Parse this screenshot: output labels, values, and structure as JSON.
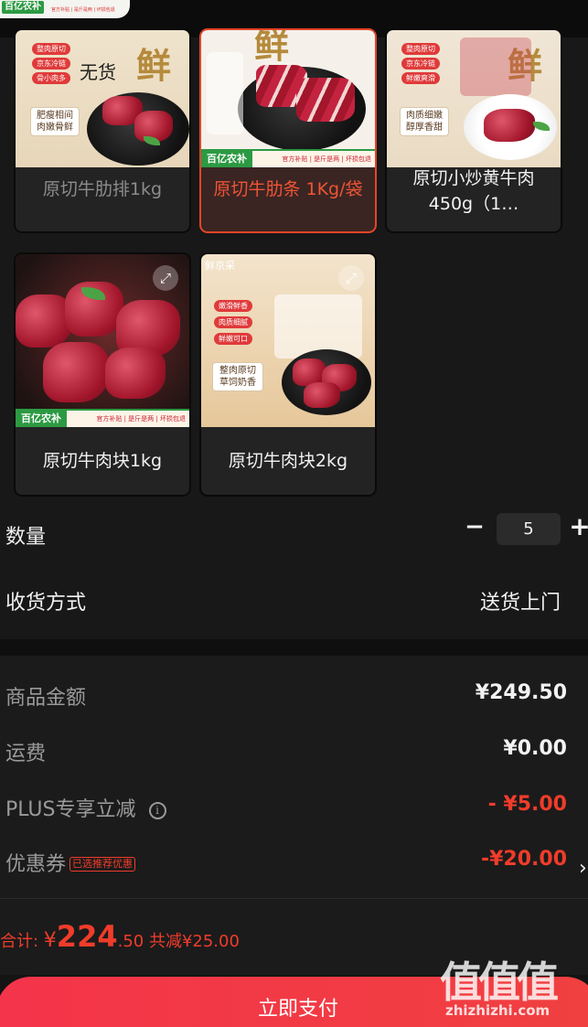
{
  "top_banner": {
    "brand": "百亿农补",
    "tagline": "官方补贴 | 是斤是两 | 坏损包退"
  },
  "products": [
    {
      "name": "原切牛肋排1kg",
      "status": "无货",
      "selected": false,
      "badges": [
        "整肉原切",
        "京东冷链",
        "骨小肉多"
      ],
      "box_text": "肥瘦相间\n肉嫩骨鲜",
      "big_char": "鲜"
    },
    {
      "name": "原切牛肋条 1Kg/袋",
      "selected": true,
      "ribbon_brand": "百亿农补",
      "ribbon_sub": "官方补贴 | 是斤是两 | 坏损包退",
      "big_char": "鲜"
    },
    {
      "name": "原切小炒黄牛肉450g（1…",
      "selected": false,
      "badges": [
        "整肉原切",
        "京东冷链",
        "鲜嫩爽滑"
      ],
      "box_text": "肉质细嫩\n醇厚香甜",
      "big_char": "鲜"
    },
    {
      "name": "原切牛肉块1kg",
      "selected": false,
      "ribbon_brand": "百亿农补",
      "ribbon_sub": "官方补贴 | 是斤是两 | 坏损包退"
    },
    {
      "name": "原切牛肉块2kg",
      "selected": false,
      "badges": [
        "嫩滑鲜香",
        "肉质细腻",
        "鲜嫩可口"
      ],
      "box_text": "整肉原切\n草饲奶香",
      "brand_corner": "鲜京采"
    }
  ],
  "quantity": {
    "label": "数量",
    "minus": "−",
    "plus": "+",
    "value": "5"
  },
  "delivery": {
    "label": "收货方式",
    "value": "送货上门"
  },
  "summary": {
    "goods_label": "商品金额",
    "goods_value": "¥249.50",
    "shipping_label": "运费",
    "shipping_value": "¥0.00",
    "plus_label": "PLUS专享立减",
    "plus_value": "- ¥5.00",
    "coupon_label": "优惠券",
    "coupon_tag": "已选推荐优惠",
    "coupon_value": "-¥20.00",
    "coupon_chevron": "›"
  },
  "total": {
    "prefix": "合计: ",
    "currency": "¥",
    "integer": "224",
    "decimal": ".50",
    "saved": " 共减¥25.00"
  },
  "pay_button": "立即支付",
  "watermark": {
    "top": "值值值",
    "bottom": "zhizhizhi.com"
  },
  "colors": {
    "accent_red": "#f03c2a",
    "pay_gradient": "#f4344a",
    "selected_border": "#e54528",
    "brand_green": "#2c9a43"
  }
}
